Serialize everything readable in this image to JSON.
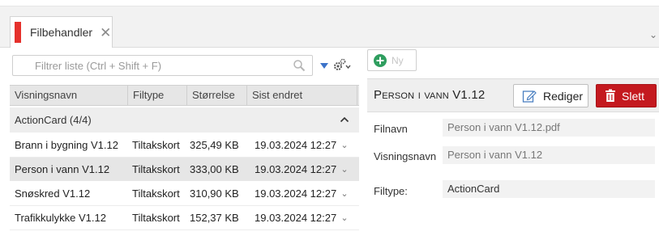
{
  "tab": {
    "label": "Filbehandler",
    "close": "✕"
  },
  "filter": {
    "placeholder": "Filtrer liste (Ctrl + Shift + F)"
  },
  "grid": {
    "columns": [
      "Visningsnavn",
      "Filtype",
      "Størrelse",
      "Sist endret"
    ],
    "group": {
      "label": "ActionCard (4/4)"
    },
    "rows": [
      {
        "name": "Brann i bygning V1.12",
        "type": "Tiltakskort",
        "size": "325,49 KB",
        "modified": "19.03.2024 12:27",
        "selected": false
      },
      {
        "name": "Person i vann V1.12",
        "type": "Tiltakskort",
        "size": "333,00 KB",
        "modified": "19.03.2024 12:27",
        "selected": true
      },
      {
        "name": "Snøskred V1.12",
        "type": "Tiltakskort",
        "size": "310,90 KB",
        "modified": "19.03.2024 12:27",
        "selected": false
      },
      {
        "name": "Trafikkulykke V1.12",
        "type": "Tiltakskort",
        "size": "152,37 KB",
        "modified": "19.03.2024 12:27",
        "selected": false
      }
    ]
  },
  "detail": {
    "new_label": "Ny",
    "title": "Person i vann V1.12",
    "edit_label": "Rediger",
    "delete_label": "Slett",
    "fields": [
      {
        "label": "Filnavn",
        "value": "Person i vann V1.12.pdf"
      },
      {
        "label": "Visningsnavn",
        "value": "Person i vann V1.12"
      },
      {
        "label": "Filtype:",
        "value": "ActionCard"
      }
    ]
  },
  "colors": {
    "accent": "#e5312c",
    "delete": "#c4191f",
    "filter_arrow": "#3c73c9",
    "new_icon": "#2f9e5f"
  }
}
